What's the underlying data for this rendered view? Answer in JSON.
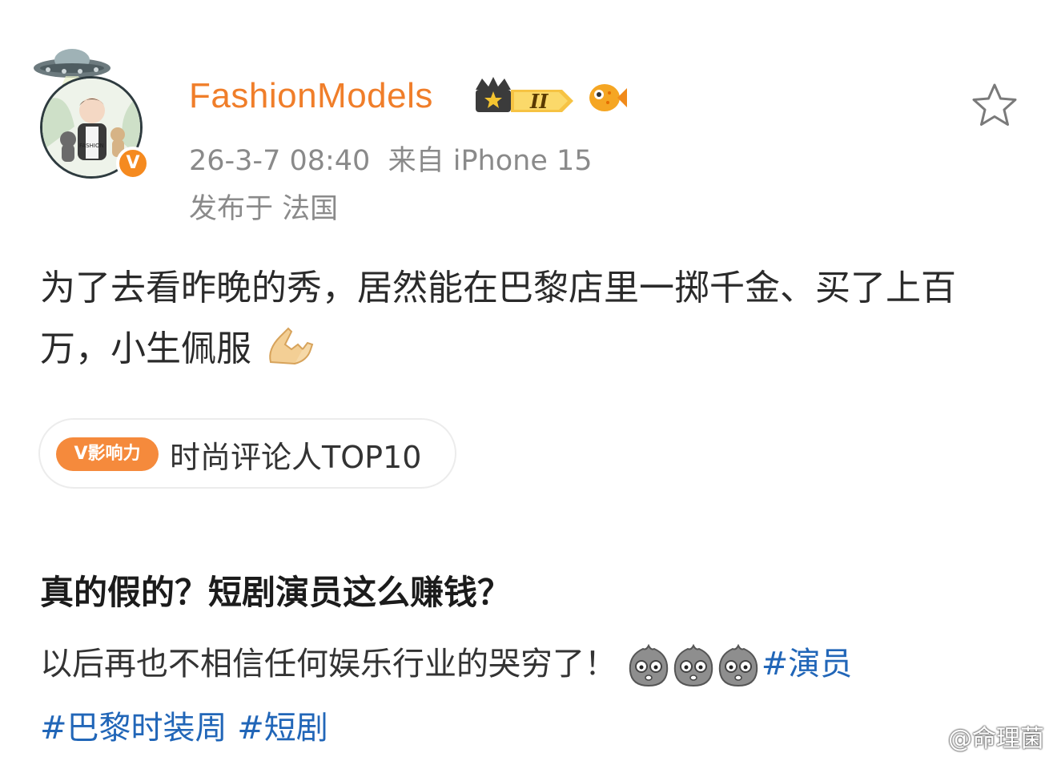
{
  "post": {
    "username": "FashionModels",
    "level_badge": "II",
    "date_time": "26-3-7 08:40",
    "source": "来自 iPhone 15",
    "location_prefix": "发布于",
    "location": "法国",
    "body": "为了去看昨晚的秀，居然能在巴黎店里一掷千金、买了上百万，小生佩服",
    "influence_tag": "V影响力",
    "influence_text": "时尚评论人TOP10",
    "avatar_text": "FASHION"
  },
  "article": {
    "headline": "真的假的？短剧演员这么赚钱？",
    "description": "以后再也不相信任何娱乐行业的哭穷了！",
    "tags": [
      "#演员",
      "#巴黎时装周",
      "#短剧"
    ]
  },
  "watermark": "@命理菌",
  "colors": {
    "username": "#f07e2a",
    "tag": "#2166b8",
    "badge": "#f58a1f"
  },
  "icons": [
    "ufo-icon",
    "verified-v-icon",
    "crown-icon",
    "level-badge-icon",
    "fish-icon",
    "star-icon",
    "prayer-hands-emoji",
    "worried-face-emoji",
    "weibo-logo-icon"
  ]
}
